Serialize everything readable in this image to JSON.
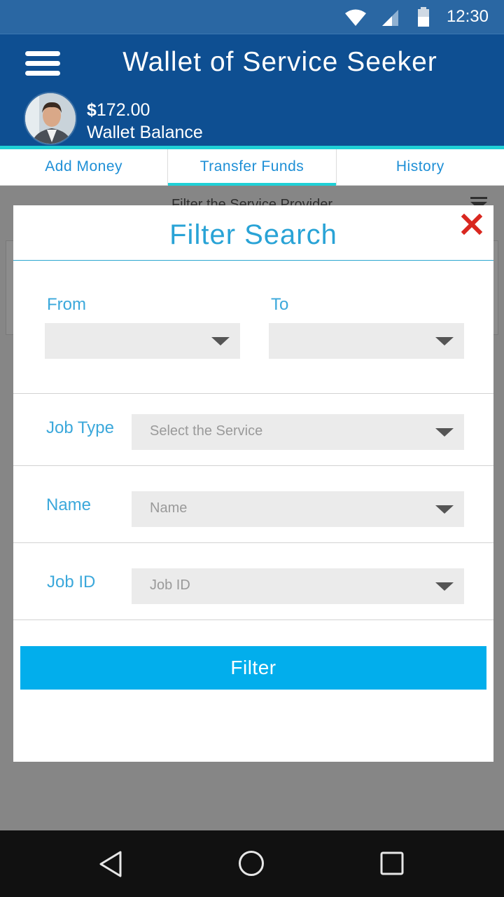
{
  "status_bar": {
    "time": "12:30",
    "icons": [
      "wifi-icon",
      "signal-icon",
      "battery-icon"
    ]
  },
  "header": {
    "title": "Wallet of Service Seeker",
    "balance_currency": "$",
    "balance_amount": "172.00",
    "balance_label": "Wallet Balance"
  },
  "tabs": [
    {
      "label": "Add Money",
      "active": false
    },
    {
      "label": "Transfer Funds",
      "active": true
    },
    {
      "label": "History",
      "active": false
    }
  ],
  "background": {
    "filter_label": "Filter the Service Provider"
  },
  "modal": {
    "title": "Filter Search",
    "from_label": "From",
    "to_label": "To",
    "job_type_label": "Job Type",
    "job_type_placeholder": "Select the Service",
    "name_label": "Name",
    "name_placeholder": "Name",
    "job_id_label": "Job ID",
    "job_id_placeholder": "Job ID",
    "filter_button": "Filter"
  },
  "nav": {
    "icons": [
      "back-icon",
      "home-icon",
      "recents-icon"
    ]
  },
  "colors": {
    "header": "#0e4f92",
    "status_bar": "#2a67a3",
    "accent": "#1fd0d6",
    "label_blue": "#3ba8db",
    "button": "#02aeec",
    "close_red": "#d9271f"
  }
}
